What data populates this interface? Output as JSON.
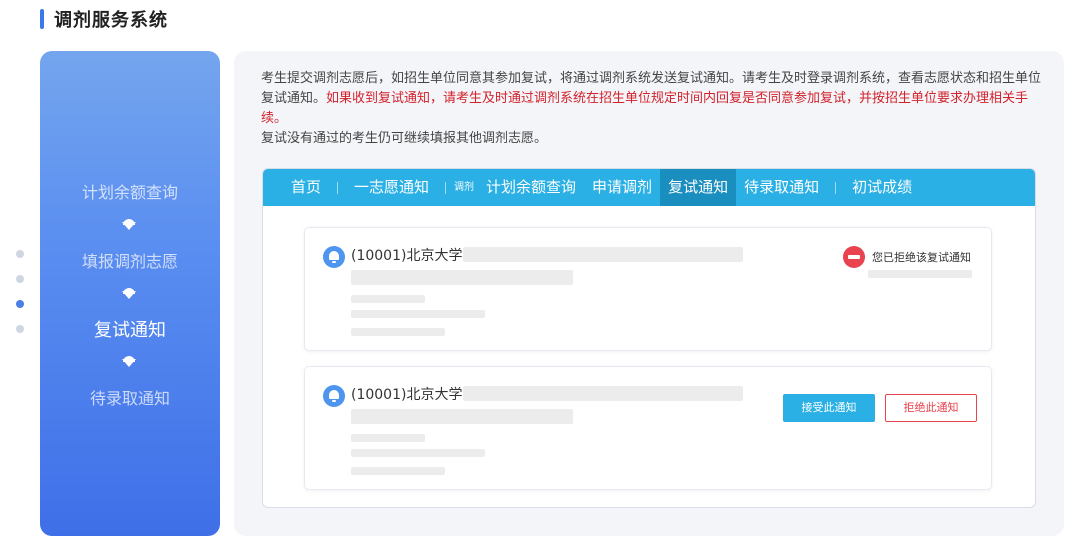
{
  "header": {
    "title": "调剂服务系统"
  },
  "steps": {
    "items": [
      {
        "label": "计划余额查询"
      },
      {
        "label": "填报调剂志愿"
      },
      {
        "label": "复试通知"
      },
      {
        "label": "待录取通知"
      }
    ],
    "active_index": 2
  },
  "intro": {
    "line1": "考生提交调剂志愿后，如招生单位同意其参加复试，将通过调剂系统发送复试通知。请考生及时登录调剂系统，查看志愿状态和招生单位复试通知。",
    "highlight": "如果收到复试通知，请考生及时通过调剂系统在招生单位规定时间内回复是否同意参加复试，并按招生单位要求办理相关手续。",
    "line2": "复试没有通过的考生仍可继续填报其他调剂志愿。"
  },
  "nav": {
    "home": "首页",
    "first_choice": "一志愿通知",
    "small_tag": "调剂",
    "plan_query": "计划余额查询",
    "apply": "申请调剂",
    "retest": "复试通知",
    "admission": "待录取通知",
    "prelim_score": "初试成绩"
  },
  "cards": [
    {
      "school": "(10001)北京大学–",
      "status": "您已拒绝该复试通知"
    },
    {
      "school": "(10001)北京大学–",
      "accept_label": "接受此通知",
      "reject_label": "拒绝此通知"
    }
  ],
  "colors": {
    "accent": "#2ab0e4",
    "danger": "#e8434e",
    "panel_blue": "#3f6fe8"
  }
}
